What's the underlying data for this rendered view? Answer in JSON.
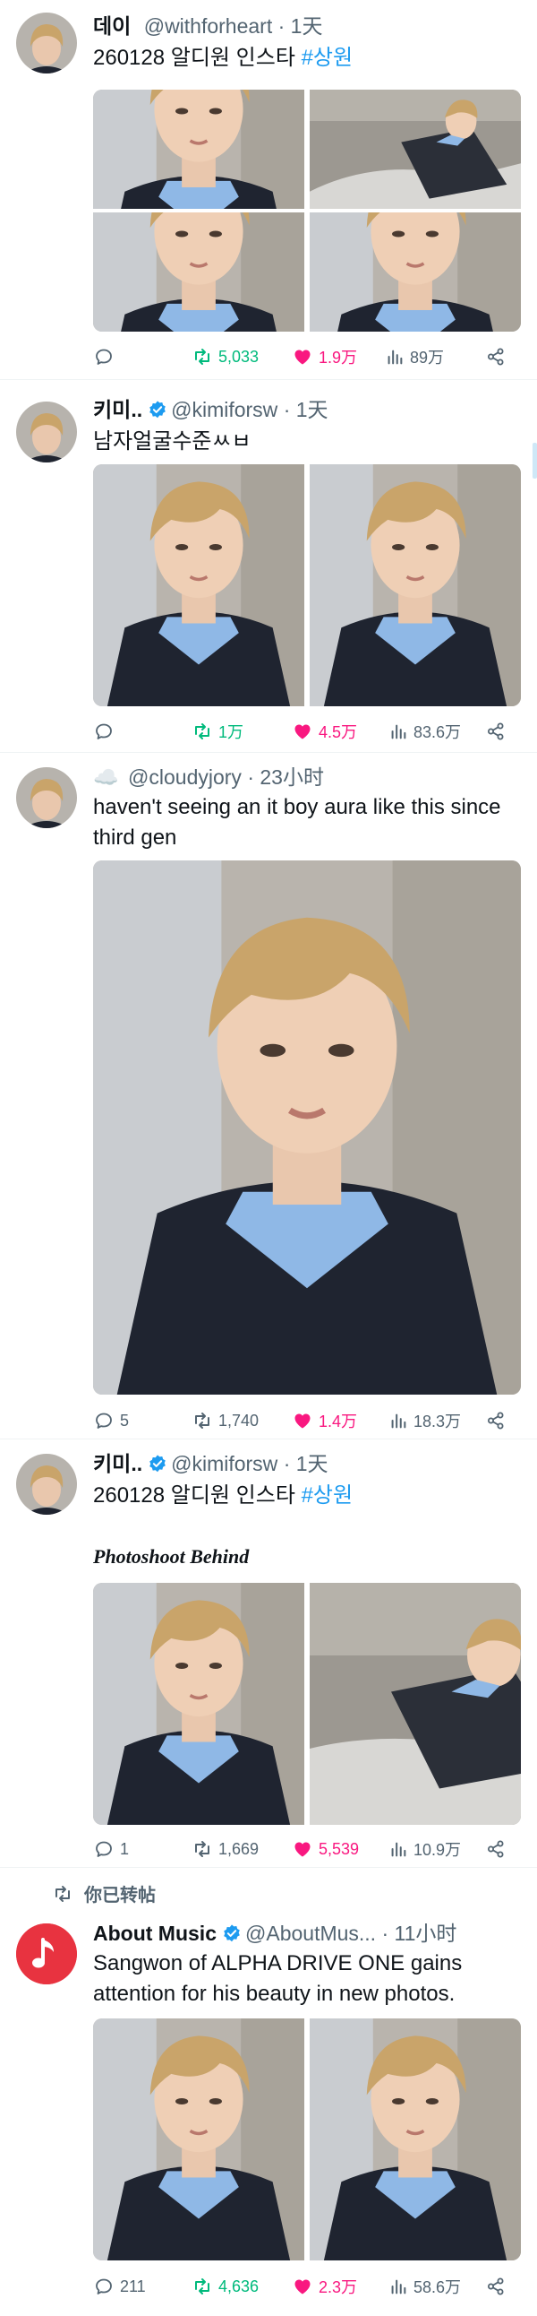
{
  "colors": {
    "accent": "#1d9bf0",
    "retweet": "#00ba7c",
    "like": "#f91880",
    "muted": "#536471"
  },
  "tweets": [
    {
      "name": "데이",
      "verified": false,
      "handle": "@withforheart",
      "time": "· 1天",
      "text": "260128 알디원 인스타 ",
      "hashtag": "#상원",
      "replies": "",
      "retweets": "5,033",
      "likes": "1.9万",
      "views": "89万"
    },
    {
      "name": "키미..",
      "verified": true,
      "handle": "@kimiforsw",
      "time": "· 1天",
      "text": "남자얼굴수준ㅆㅂ",
      "replies": "",
      "retweets": "1万",
      "likes": "4.5万",
      "views": "83.6万"
    },
    {
      "name": "☁️",
      "verified": false,
      "handle": "@cloudyjory",
      "time": "· 23小时",
      "text": "haven't seeing an it boy aura like this since third gen",
      "replies": "5",
      "retweets": "1,740",
      "likes": "1.4万",
      "views": "18.3万"
    },
    {
      "name": "키미..",
      "verified": true,
      "handle": "@kimiforsw",
      "time": "· 1天",
      "text": "260128 알디원 인스타 ",
      "hashtag": "#상원",
      "caption": "Photoshoot Behind",
      "replies": "1",
      "retweets": "1,669",
      "likes": "5,539",
      "views": "10.9万"
    },
    {
      "repost_label": "你已转帖",
      "name": "About Music",
      "verified": true,
      "handle": "@AboutMus...",
      "time": "· 11小时",
      "text": "Sangwon of ALPHA DRIVE ONE gains attention for his beauty in new photos.",
      "replies": "211",
      "retweets": "4,636",
      "likes": "2.3万",
      "views": "58.6万"
    }
  ]
}
